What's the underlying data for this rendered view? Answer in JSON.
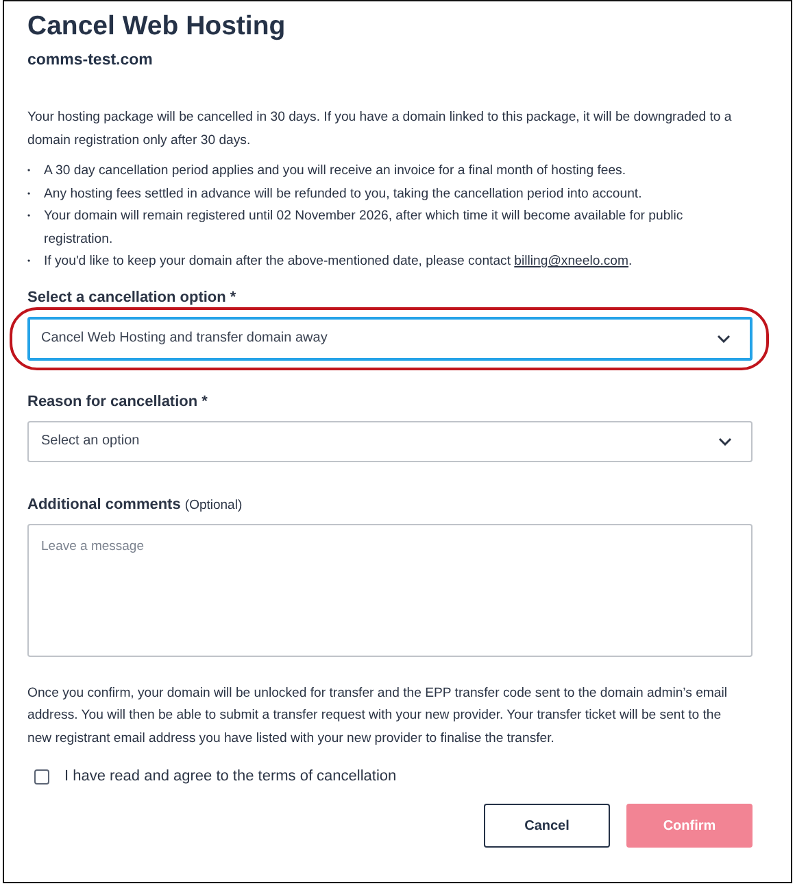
{
  "title": "Cancel Web Hosting",
  "domain": "comms-test.com",
  "intro": "Your hosting package will be cancelled in 30 days. If you have a domain linked to this package, it will be downgraded to a domain registration only after 30 days.",
  "bullets": [
    {
      "marker": "•",
      "text": "A 30 day cancellation period applies and you will receive an invoice for a final month of hosting fees."
    },
    {
      "marker": "•",
      "text": "Any hosting fees settled in advance will be refunded to you, taking the cancellation period into account."
    },
    {
      "marker": "•",
      "text": "Your domain will remain registered until 02 November 2026, after which time it will become available for public registration."
    },
    {
      "marker": "•",
      "text": "If you'd like to keep your domain after the above-mentioned date, please contact ",
      "link": "billing@xneelo.com",
      "after": "."
    }
  ],
  "fields": [
    {
      "kind": "select",
      "label": "Select a cancellation option *",
      "value": "Cancel Web Hosting and transfer domain away",
      "focused": true,
      "highlighted": true
    },
    {
      "kind": "select",
      "label": "Reason for cancellation *",
      "value": "Select an option",
      "focused": false,
      "highlighted": false
    },
    {
      "kind": "textarea",
      "label": "Additional comments",
      "hint": "(Optional)",
      "placeholder": "Leave a message"
    }
  ],
  "notice": "Once you confirm, your domain will be unlocked for transfer and the EPP transfer code sent to the domain admin’s email address. You will then be able to submit a transfer request with your new provider. Your transfer ticket will be sent to the new registrant email address you have listed with your new provider to finalise the transfer.",
  "agreement": {
    "label": "I have read and agree to the terms of cancellation",
    "checked": false
  },
  "buttons": [
    {
      "label": "Cancel",
      "kind": "secondary",
      "disabled": false
    },
    {
      "label": "Confirm",
      "kind": "primary",
      "disabled": true
    }
  ]
}
